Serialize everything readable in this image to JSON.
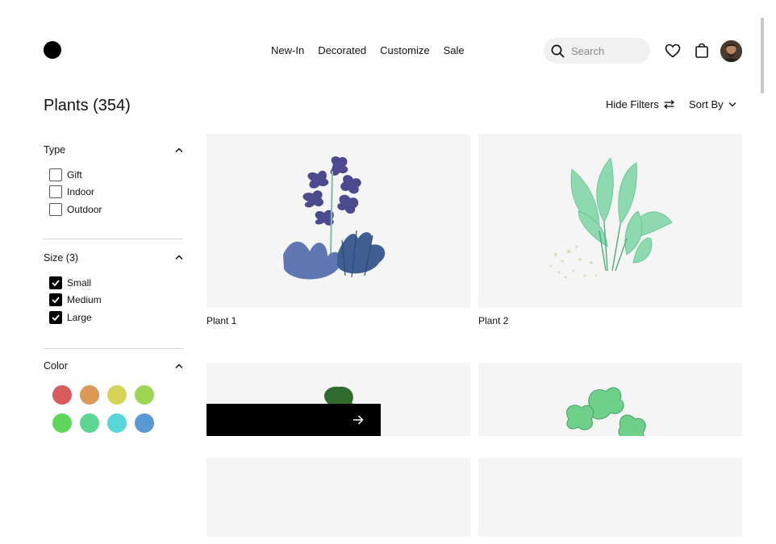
{
  "nav": {
    "items": [
      "New-In",
      "Decorated",
      "Customize",
      "Sale"
    ]
  },
  "search": {
    "placeholder": "Search"
  },
  "page": {
    "title": "Plants (354)"
  },
  "toolbar": {
    "hide_filters": "Hide Filters",
    "sort_by": "Sort By"
  },
  "filters": {
    "type": {
      "label": "Type",
      "options": [
        {
          "label": "Gift",
          "checked": false
        },
        {
          "label": "Indoor",
          "checked": false
        },
        {
          "label": "Outdoor",
          "checked": false
        }
      ]
    },
    "size": {
      "label": "Size (3)",
      "options": [
        {
          "label": "Small",
          "checked": true
        },
        {
          "label": "Medium",
          "checked": true
        },
        {
          "label": "Large",
          "checked": true
        }
      ]
    },
    "color": {
      "label": "Color",
      "swatches": [
        "#d65d5b",
        "#d99a58",
        "#d6d456",
        "#9cd653",
        "#5ed65b",
        "#5ed693",
        "#58d6d6",
        "#5b98d6"
      ]
    }
  },
  "products": [
    {
      "name": "Plant 1"
    },
    {
      "name": "Plant 2"
    },
    {
      "name": ""
    },
    {
      "name": ""
    }
  ],
  "icons": {
    "search": "search-icon",
    "wishlist": "heart-icon",
    "bag": "shopping-bag-icon",
    "filters": "sliders-icon",
    "sort": "chevron-down-icon",
    "next": "arrow-right-icon"
  }
}
